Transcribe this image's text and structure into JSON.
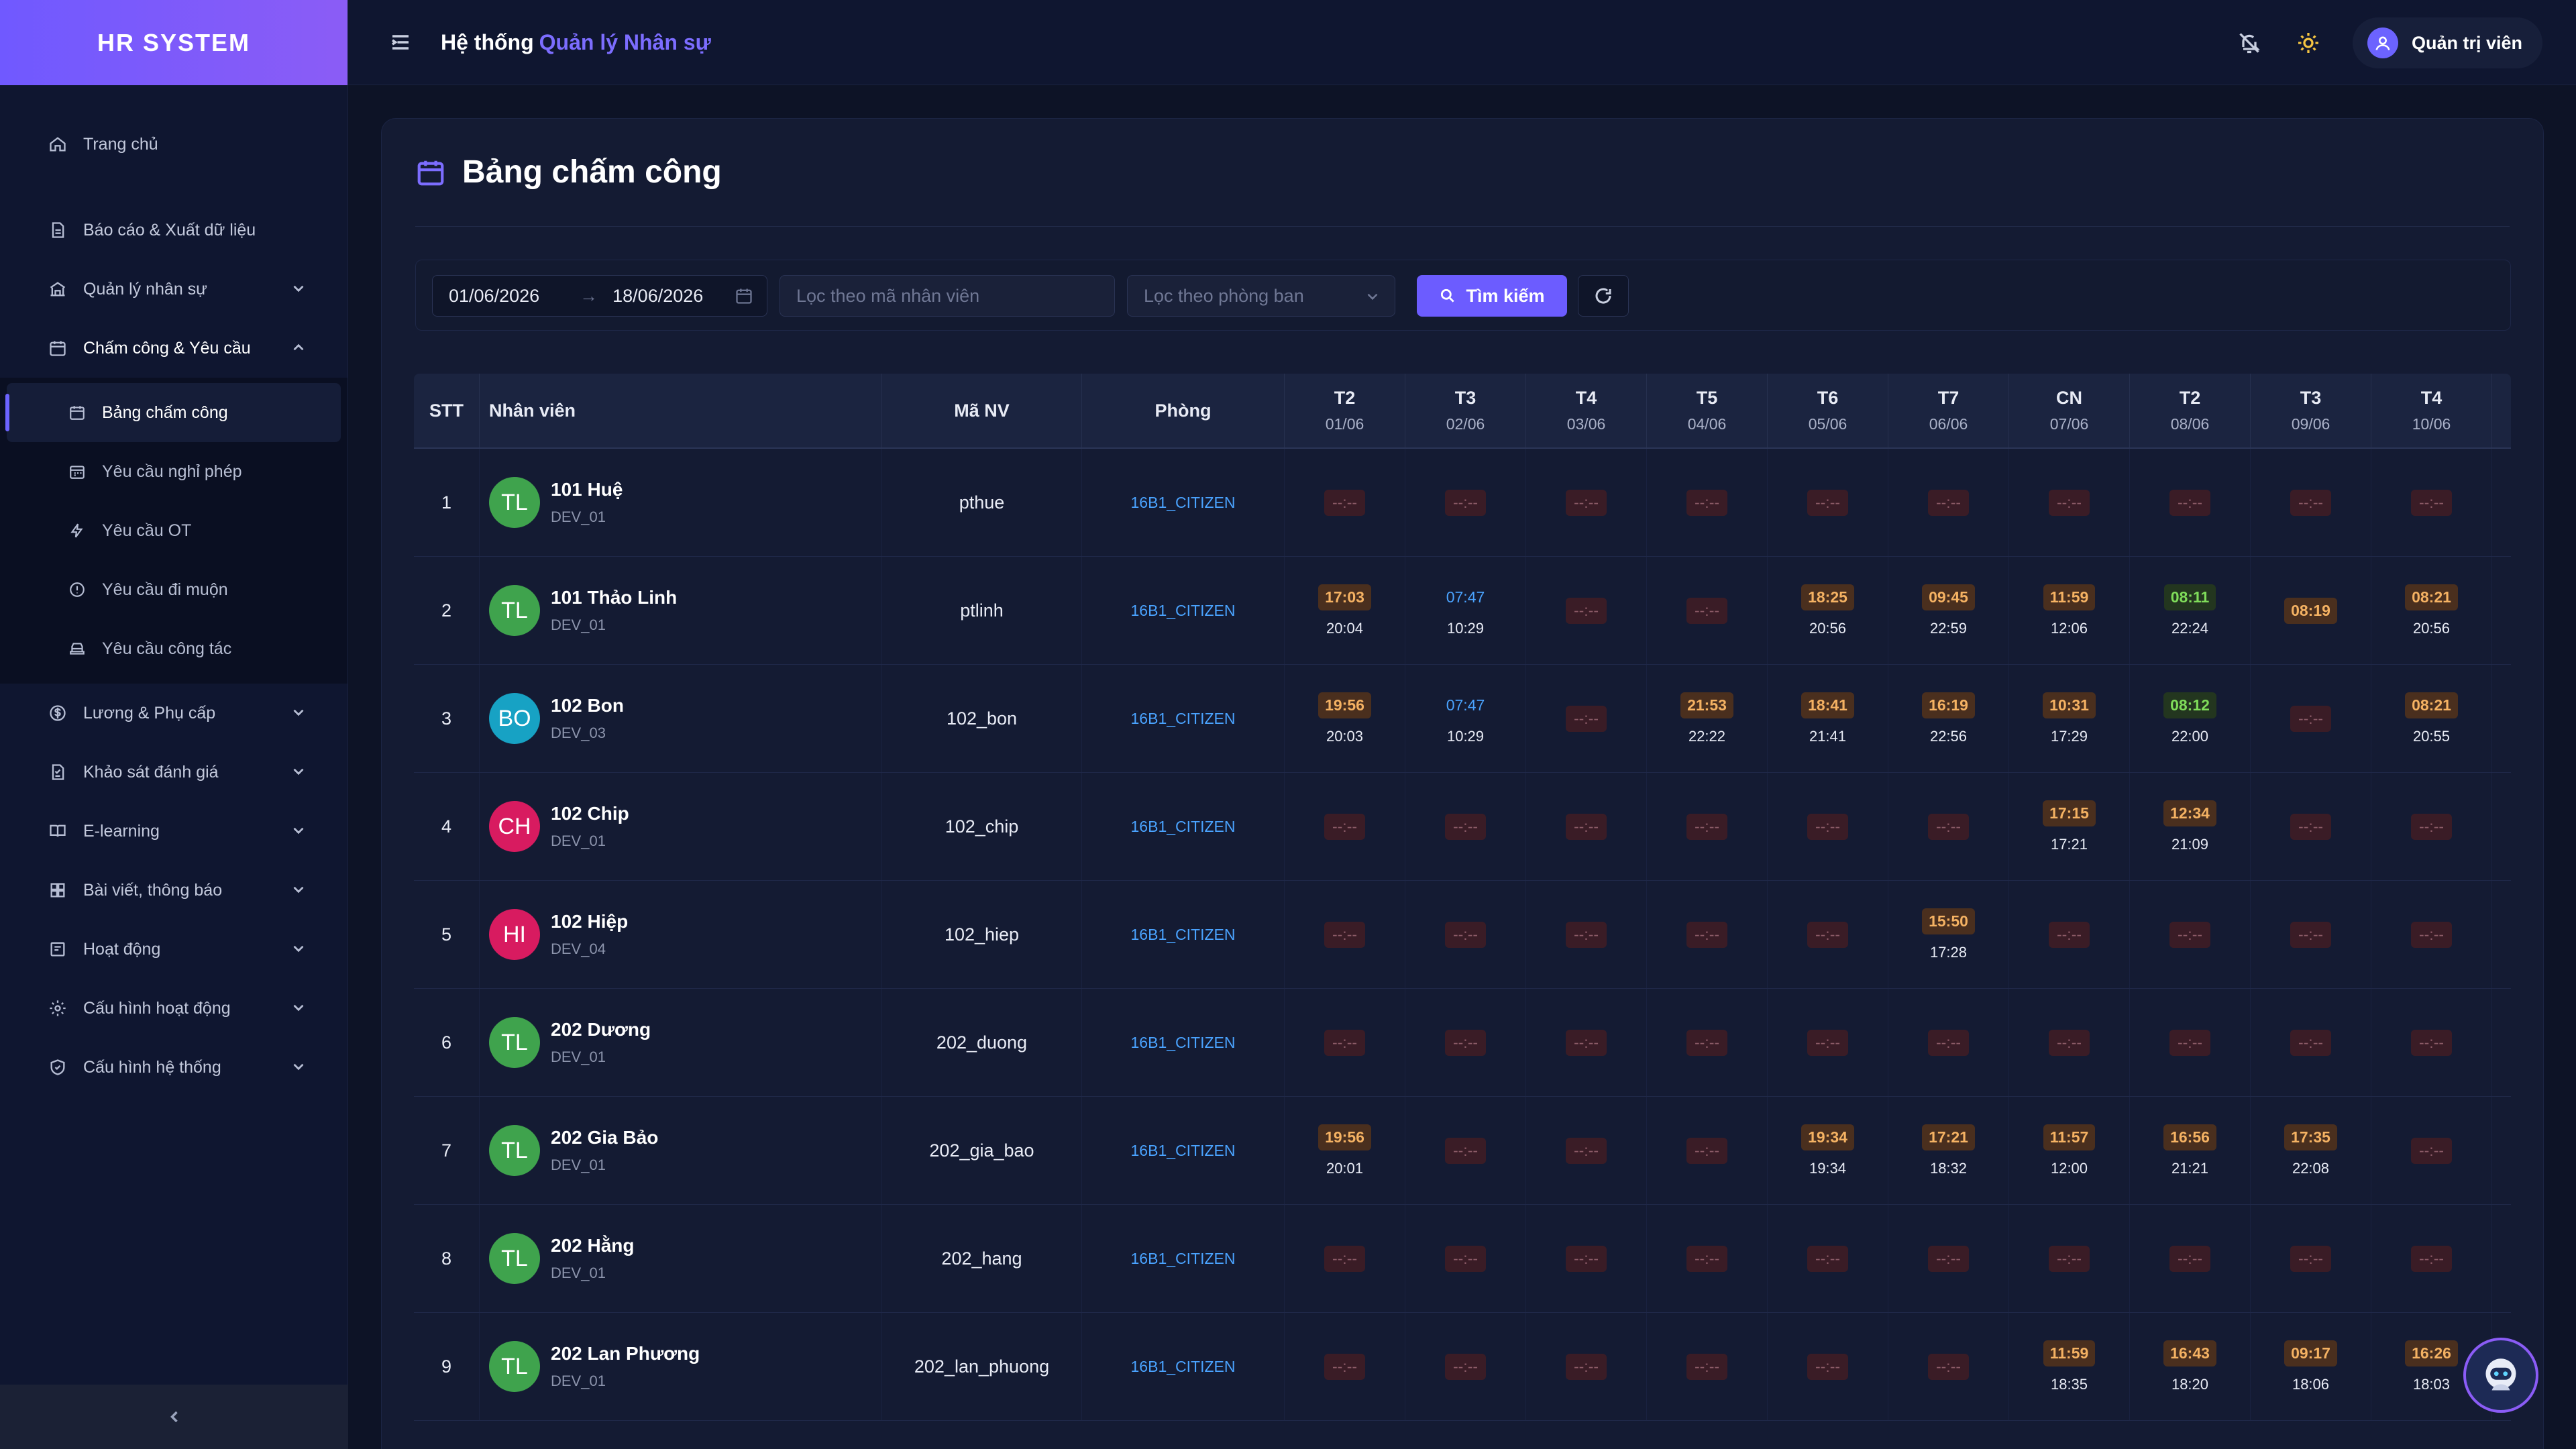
{
  "brand": "HR SYSTEM",
  "header": {
    "title_prefix": "Hệ thống",
    "title_accent": "Quản lý Nhân sự",
    "user_name": "Quản trị viên"
  },
  "sidebar": {
    "items": [
      {
        "label": "Trang chủ",
        "icon": "home-icon"
      },
      {
        "label": "Báo cáo & Xuất dữ liệu",
        "icon": "report-icon"
      },
      {
        "label": "Quản lý nhân sự",
        "icon": "building-icon"
      },
      {
        "label": "Chấm công & Yêu cầu",
        "icon": "calendar-icon"
      },
      {
        "label": "Lương & Phụ cấp",
        "icon": "dollar-icon"
      },
      {
        "label": "Khảo sát đánh giá",
        "icon": "survey-icon"
      },
      {
        "label": "E-learning",
        "icon": "book-icon"
      },
      {
        "label": "Bài viết, thông báo",
        "icon": "grid-icon"
      },
      {
        "label": "Hoạt động",
        "icon": "activity-icon"
      },
      {
        "label": "Cấu hình hoạt động",
        "icon": "gear-icon"
      },
      {
        "label": "Cấu hình hệ thống",
        "icon": "shield-icon"
      }
    ],
    "submenu": [
      {
        "label": "Bảng chấm công",
        "icon": "calendar-icon"
      },
      {
        "label": "Yêu cầu nghỉ phép",
        "icon": "calendar-x-icon"
      },
      {
        "label": "Yêu cầu OT",
        "icon": "bolt-icon"
      },
      {
        "label": "Yêu cầu đi muộn",
        "icon": "alert-circle-icon"
      },
      {
        "label": "Yêu cầu công tác",
        "icon": "car-icon"
      }
    ]
  },
  "page": {
    "title": "Bảng chấm công",
    "filter": {
      "date_from": "01/06/2026",
      "date_to": "18/06/2026",
      "emp_placeholder": "Lọc theo mã nhân viên",
      "dept_placeholder": "Lọc theo phòng ban",
      "search_label": "Tìm kiếm"
    },
    "columns": {
      "stt": "STT",
      "employee": "Nhân viên",
      "code": "Mã NV",
      "dept": "Phòng",
      "days": [
        {
          "d": "T2",
          "date": "01/06"
        },
        {
          "d": "T3",
          "date": "02/06"
        },
        {
          "d": "T4",
          "date": "03/06"
        },
        {
          "d": "T5",
          "date": "04/06"
        },
        {
          "d": "T6",
          "date": "05/06"
        },
        {
          "d": "T7",
          "date": "06/06"
        },
        {
          "d": "CN",
          "date": "07/06"
        },
        {
          "d": "T2",
          "date": "08/06"
        },
        {
          "d": "T3",
          "date": "09/06"
        },
        {
          "d": "T4",
          "date": "10/06"
        }
      ]
    },
    "rows": [
      {
        "stt": "1",
        "initials": "TL",
        "avatar_color": "#3fa34d",
        "name": "101 Huệ",
        "pos": "DEV_01",
        "code": "pthue",
        "dept": "16B1_CITIZEN",
        "days": [
          [
            "",
            "",
            "e"
          ],
          [
            "",
            "",
            "e"
          ],
          [
            "",
            "",
            "e"
          ],
          [
            "",
            "",
            "e"
          ],
          [
            "",
            "",
            "e"
          ],
          [
            "",
            "",
            "e"
          ],
          [
            "",
            "",
            "e"
          ],
          [
            "",
            "",
            "e"
          ],
          [
            "",
            "",
            "e"
          ],
          [
            "",
            "",
            "e"
          ]
        ]
      },
      {
        "stt": "2",
        "initials": "TL",
        "avatar_color": "#3fa34d",
        "name": "101 Thảo Linh",
        "pos": "DEV_01",
        "code": "ptlinh",
        "dept": "16B1_CITIZEN",
        "days": [
          [
            "17:03",
            "20:04",
            "in"
          ],
          [
            "07:47",
            "10:29",
            "early"
          ],
          [
            "",
            "",
            "e"
          ],
          [
            "",
            "",
            "e"
          ],
          [
            "18:25",
            "20:56",
            "in"
          ],
          [
            "09:45",
            "22:59",
            "in"
          ],
          [
            "11:59",
            "12:06",
            "in"
          ],
          [
            "08:11",
            "22:24",
            "green"
          ],
          [
            "08:19",
            "",
            "in"
          ],
          [
            "08:21",
            "20:56",
            "in"
          ]
        ]
      },
      {
        "stt": "3",
        "initials": "BO",
        "avatar_color": "#17a2c4",
        "name": "102 Bon",
        "pos": "DEV_03",
        "code": "102_bon",
        "dept": "16B1_CITIZEN",
        "days": [
          [
            "19:56",
            "20:03",
            "in"
          ],
          [
            "07:47",
            "10:29",
            "early"
          ],
          [
            "",
            "",
            "e"
          ],
          [
            "21:53",
            "22:22",
            "in"
          ],
          [
            "18:41",
            "21:41",
            "in"
          ],
          [
            "16:19",
            "22:56",
            "in"
          ],
          [
            "10:31",
            "17:29",
            "in"
          ],
          [
            "08:12",
            "22:00",
            "green"
          ],
          [
            "",
            "",
            "e"
          ],
          [
            "08:21",
            "20:55",
            "in"
          ]
        ]
      },
      {
        "stt": "4",
        "initials": "CH",
        "avatar_color": "#d81b60",
        "name": "102 Chip",
        "pos": "DEV_01",
        "code": "102_chip",
        "dept": "16B1_CITIZEN",
        "days": [
          [
            "",
            "",
            "e"
          ],
          [
            "",
            "",
            "e"
          ],
          [
            "",
            "",
            "e"
          ],
          [
            "",
            "",
            "e"
          ],
          [
            "",
            "",
            "e"
          ],
          [
            "",
            "",
            "e"
          ],
          [
            "17:15",
            "17:21",
            "in"
          ],
          [
            "12:34",
            "21:09",
            "in"
          ],
          [
            "",
            "",
            "e"
          ],
          [
            "",
            "",
            "e"
          ]
        ]
      },
      {
        "stt": "5",
        "initials": "HI",
        "avatar_color": "#d81b60",
        "name": "102 Hiệp",
        "pos": "DEV_04",
        "code": "102_hiep",
        "dept": "16B1_CITIZEN",
        "days": [
          [
            "",
            "",
            "e"
          ],
          [
            "",
            "",
            "e"
          ],
          [
            "",
            "",
            "e"
          ],
          [
            "",
            "",
            "e"
          ],
          [
            "",
            "",
            "e"
          ],
          [
            "15:50",
            "17:28",
            "in"
          ],
          [
            "",
            "",
            "e"
          ],
          [
            "",
            "",
            "e"
          ],
          [
            "",
            "",
            "e"
          ],
          [
            "",
            "",
            "e"
          ]
        ]
      },
      {
        "stt": "6",
        "initials": "TL",
        "avatar_color": "#3fa34d",
        "name": "202 Dương",
        "pos": "DEV_01",
        "code": "202_duong",
        "dept": "16B1_CITIZEN",
        "days": [
          [
            "",
            "",
            "e"
          ],
          [
            "",
            "",
            "e"
          ],
          [
            "",
            "",
            "e"
          ],
          [
            "",
            "",
            "e"
          ],
          [
            "",
            "",
            "e"
          ],
          [
            "",
            "",
            "e"
          ],
          [
            "",
            "",
            "e"
          ],
          [
            "",
            "",
            "e"
          ],
          [
            "",
            "",
            "e"
          ],
          [
            "",
            "",
            "e"
          ]
        ]
      },
      {
        "stt": "7",
        "initials": "TL",
        "avatar_color": "#3fa34d",
        "name": "202 Gia Bảo",
        "pos": "DEV_01",
        "code": "202_gia_bao",
        "dept": "16B1_CITIZEN",
        "days": [
          [
            "19:56",
            "20:01",
            "in"
          ],
          [
            "",
            "",
            "e"
          ],
          [
            "",
            "",
            "e"
          ],
          [
            "",
            "",
            "e"
          ],
          [
            "19:34",
            "19:34",
            "in"
          ],
          [
            "17:21",
            "18:32",
            "in"
          ],
          [
            "11:57",
            "12:00",
            "in"
          ],
          [
            "16:56",
            "21:21",
            "in"
          ],
          [
            "17:35",
            "22:08",
            "in"
          ],
          [
            "",
            "",
            "e"
          ]
        ]
      },
      {
        "stt": "8",
        "initials": "TL",
        "avatar_color": "#3fa34d",
        "name": "202 Hằng",
        "pos": "DEV_01",
        "code": "202_hang",
        "dept": "16B1_CITIZEN",
        "days": [
          [
            "",
            "",
            "e"
          ],
          [
            "",
            "",
            "e"
          ],
          [
            "",
            "",
            "e"
          ],
          [
            "",
            "",
            "e"
          ],
          [
            "",
            "",
            "e"
          ],
          [
            "",
            "",
            "e"
          ],
          [
            "",
            "",
            "e"
          ],
          [
            "",
            "",
            "e"
          ],
          [
            "",
            "",
            "e"
          ],
          [
            "",
            "",
            "e"
          ]
        ]
      },
      {
        "stt": "9",
        "initials": "TL",
        "avatar_color": "#3fa34d",
        "name": "202 Lan Phương",
        "pos": "DEV_01",
        "code": "202_lan_phuong",
        "dept": "16B1_CITIZEN",
        "days": [
          [
            "",
            "",
            "e"
          ],
          [
            "",
            "",
            "e"
          ],
          [
            "",
            "",
            "e"
          ],
          [
            "",
            "",
            "e"
          ],
          [
            "",
            "",
            "e"
          ],
          [
            "",
            "",
            "e"
          ],
          [
            "11:59",
            "18:35",
            "in"
          ],
          [
            "16:43",
            "18:20",
            "in"
          ],
          [
            "09:17",
            "18:06",
            "in"
          ],
          [
            "16:26",
            "18:03",
            "in"
          ]
        ]
      }
    ],
    "empty_time": "--:--"
  }
}
